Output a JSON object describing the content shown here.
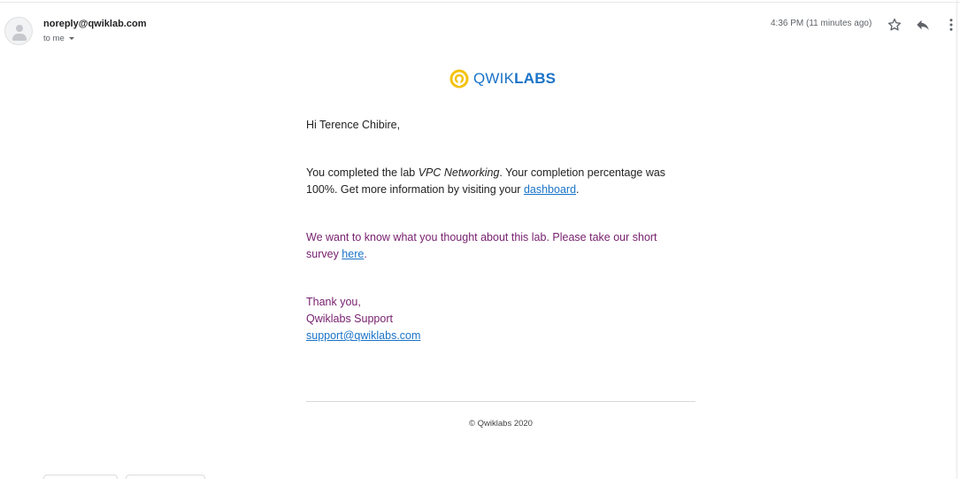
{
  "header": {
    "sender": "noreply@qwiklab.com",
    "recipient": "to me",
    "timestamp": "4:36 PM (11 minutes ago)",
    "icons": {
      "avatar": "avatar-icon",
      "star": "star-icon",
      "reply": "reply-icon",
      "more": "more-vert-icon",
      "recipient_dropdown": "caret-down-icon"
    }
  },
  "email": {
    "logo": {
      "icon": "qwiklabs-logo-icon",
      "word_light": "QWIK",
      "word_bold": "LABS",
      "color": "#1a73c8",
      "mark_color": "#f4c20d"
    },
    "greeting": "Hi Terence Chibire,",
    "completion": {
      "part1": "You completed the lab ",
      "lab_name": "VPC Networking",
      "part2": ". Your completion percentage was",
      "part3": "100%. Get more information by visiting your ",
      "dashboard_link": "dashboard",
      "part4": "."
    },
    "survey": {
      "line1": "We want to know what you thought about this lab. Please take our short",
      "line2_prefix": "survey ",
      "link": "here",
      "line2_suffix": "."
    },
    "signoff": {
      "thanks": "Thank you,",
      "team": "Qwiklabs Support",
      "email_link": "support@qwiklabs.com"
    },
    "footer": {
      "copyright": "© Qwiklabs 2020"
    }
  },
  "colors": {
    "link": "#1a73c8",
    "survey_text": "#78216f",
    "muted": "#5f6368"
  }
}
